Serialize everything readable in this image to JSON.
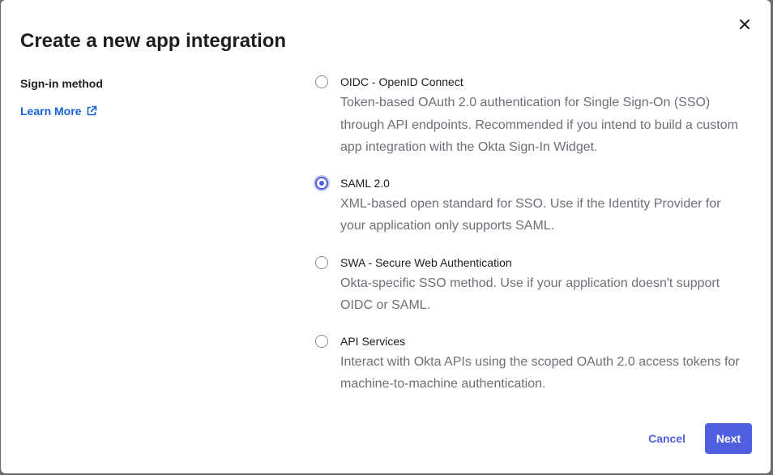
{
  "dialog": {
    "title": "Create a new app integration",
    "close_icon": "close-icon"
  },
  "sidebar": {
    "section_label": "Sign-in method",
    "learn_more": "Learn More",
    "learn_more_icon": "external-link-icon"
  },
  "options": [
    {
      "label": "OIDC - OpenID Connect",
      "description": "Token-based OAuth 2.0 authentication for Single Sign-On (SSO) through API endpoints. Recommended if you intend to build a custom app integration with the Okta Sign-In Widget.",
      "selected": false
    },
    {
      "label": "SAML 2.0",
      "description": "XML-based open standard for SSO. Use if the Identity Provider for your application only supports SAML.",
      "selected": true
    },
    {
      "label": "SWA - Secure Web Authentication",
      "description": "Okta-specific SSO method. Use if your application doesn't support OIDC or SAML.",
      "selected": false
    },
    {
      "label": "API Services",
      "description": "Interact with Okta APIs using the scoped OAuth 2.0 access tokens for machine-to-machine authentication.",
      "selected": false
    }
  ],
  "footer": {
    "cancel_label": "Cancel",
    "next_label": "Next"
  },
  "colors": {
    "accent": "#4f5fdf",
    "link": "#1662dd",
    "text": "#1d1d21",
    "muted_text": "#6e6e78"
  }
}
